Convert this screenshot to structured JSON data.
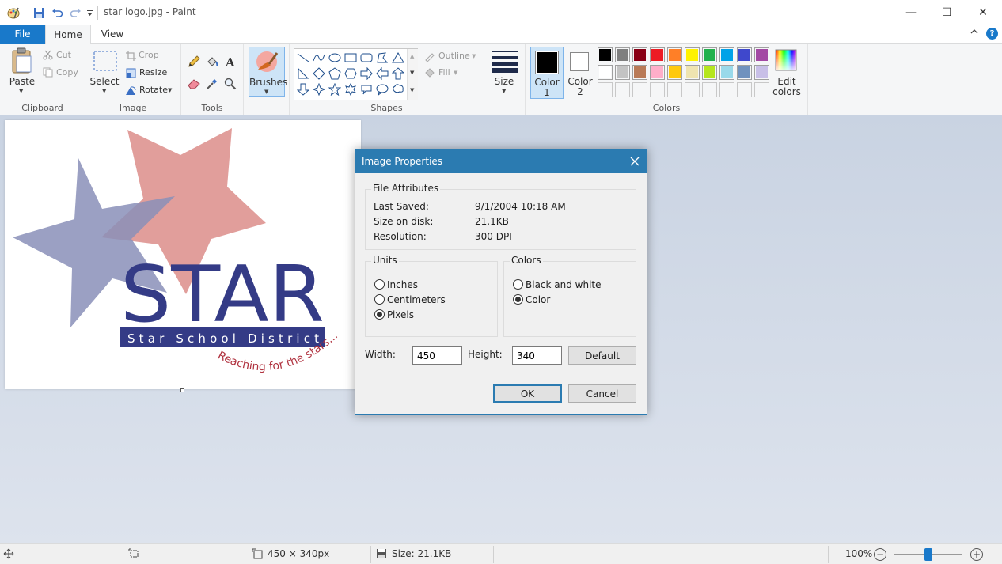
{
  "window": {
    "title": "star logo.jpg - Paint",
    "minimize_glyph": "—",
    "maximize_glyph": "☐",
    "close_glyph": "✕"
  },
  "tabs": {
    "file": "File",
    "home": "Home",
    "view": "View"
  },
  "ribbon": {
    "clipboard": {
      "label": "Clipboard",
      "paste": "Paste",
      "cut": "Cut",
      "copy": "Copy"
    },
    "image": {
      "label": "Image",
      "select": "Select",
      "crop": "Crop",
      "resize": "Resize",
      "rotate": "Rotate"
    },
    "tools": {
      "label": "Tools"
    },
    "brushes": {
      "label": "Brushes"
    },
    "shapes": {
      "label": "Shapes",
      "outline": "Outline",
      "fill": "Fill"
    },
    "size": {
      "label": "Size"
    },
    "colors": {
      "label": "Colors",
      "color1": "Color 1",
      "color1_line1": "Color",
      "color1_line2": "1",
      "color2_line1": "Color",
      "color2_line2": "2",
      "edit_line1": "Edit",
      "edit_line2": "colors",
      "color1_value": "#000000",
      "color2_value": "#ffffff",
      "palette_row1": [
        "#000000",
        "#7f7f7f",
        "#880015",
        "#ed1c24",
        "#ff7f27",
        "#fff200",
        "#22b14c",
        "#00a2e8",
        "#3f48cc",
        "#a349a4"
      ],
      "palette_row2": [
        "#ffffff",
        "#c3c3c3",
        "#b97a57",
        "#ffaec9",
        "#ffc90e",
        "#efe4b0",
        "#b5e61d",
        "#99d9ea",
        "#7092be",
        "#c8bfe7"
      ]
    }
  },
  "canvas_image": {
    "logo_text": "STAR",
    "banner_text": "Star School District",
    "tagline": "Reaching for the stars..."
  },
  "dialog": {
    "title": "Image Properties",
    "file_attributes": {
      "legend": "File Attributes",
      "last_saved_label": "Last Saved:",
      "last_saved_value": "9/1/2004 10:18 AM",
      "size_label": "Size on disk:",
      "size_value": "21.1KB",
      "resolution_label": "Resolution:",
      "resolution_value": "300 DPI"
    },
    "units": {
      "legend": "Units",
      "inches": "Inches",
      "centimeters": "Centimeters",
      "pixels": "Pixels",
      "selected": "pixels"
    },
    "colors": {
      "legend": "Colors",
      "bw": "Black and white",
      "color": "Color",
      "selected": "color"
    },
    "width_label": "Width:",
    "width_value": "450",
    "height_label": "Height:",
    "height_value": "340",
    "default_btn": "Default",
    "ok_btn": "OK",
    "cancel_btn": "Cancel"
  },
  "status": {
    "dimensions": "450 × 340px",
    "size": "Size: 21.1KB",
    "zoom": "100%"
  }
}
